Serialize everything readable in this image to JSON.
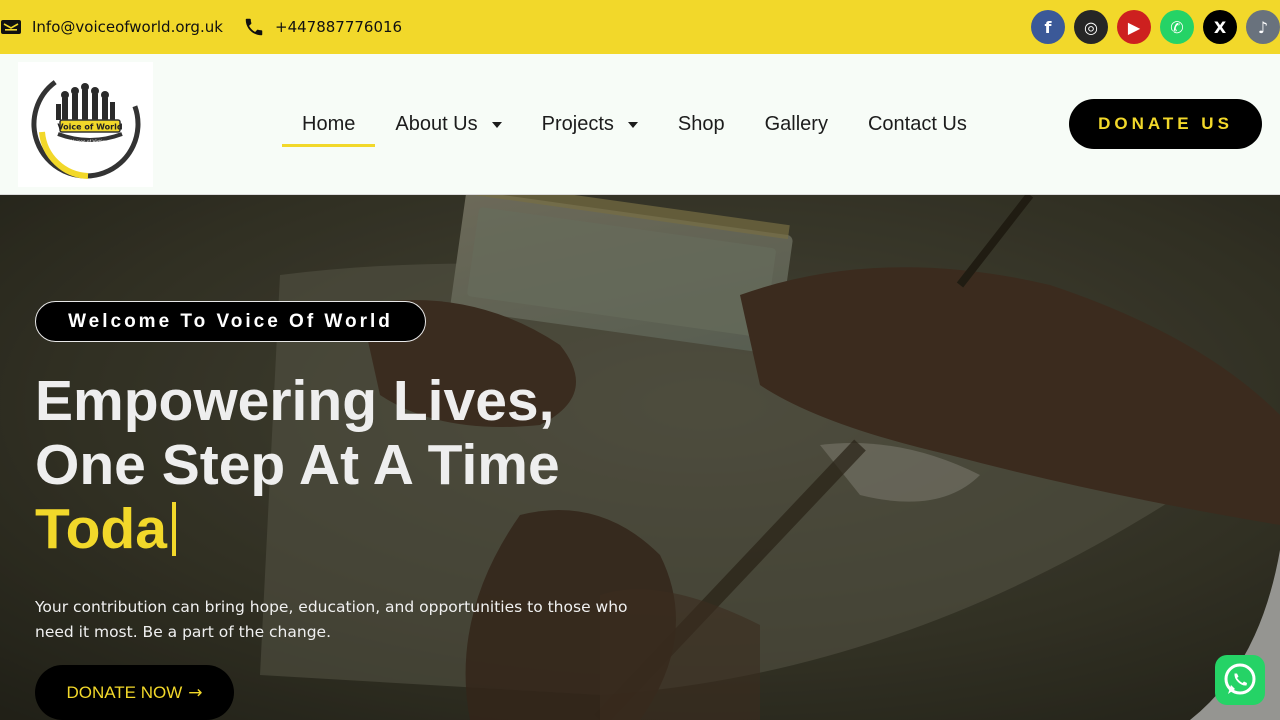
{
  "topbar": {
    "email": "Info@voiceofworld.org.uk",
    "phone": "+447887776016",
    "bg_color": "#f2d82a",
    "icons": {
      "email": "email-icon",
      "phone": "phone-icon"
    },
    "socials": [
      {
        "name": "facebook-icon",
        "glyph": "f",
        "color": "#3b5998"
      },
      {
        "name": "instagram-icon",
        "glyph": "◎",
        "color": "#262626"
      },
      {
        "name": "youtube-icon",
        "glyph": "▶",
        "color": "#cd201f"
      },
      {
        "name": "whatsapp-icon",
        "glyph": "✆",
        "color": "#25d366"
      },
      {
        "name": "x-icon",
        "glyph": "X",
        "color": "#000000"
      },
      {
        "name": "tiktok-icon",
        "glyph": "♪",
        "color": "#69727d"
      }
    ]
  },
  "header": {
    "logo_text": "Voice of World",
    "logo_subtext": "Voices of Victims",
    "nav": [
      {
        "label": "Home",
        "active": true,
        "dropdown": false
      },
      {
        "label": "About Us",
        "active": false,
        "dropdown": true
      },
      {
        "label": "Projects",
        "active": false,
        "dropdown": true
      },
      {
        "label": "Shop",
        "active": false,
        "dropdown": false
      },
      {
        "label": "Gallery",
        "active": false,
        "dropdown": false
      },
      {
        "label": "Contact Us",
        "active": false,
        "dropdown": false
      }
    ],
    "donate_label": "DONATE US"
  },
  "hero": {
    "welcome": "Welcome To Voice Of World",
    "headline_line1": "Empowering Lives,",
    "headline_line2": "One Step At A Time",
    "typed_text": "Toda",
    "subtext": "Your contribution can bring hope, education, and opportunities to those who need it most. Be a part of the change.",
    "cta_label": "DONATE NOW",
    "cta_icon": "arrow-right-icon"
  },
  "floating": {
    "icon": "whatsapp-chat-icon",
    "color": "#25d366"
  }
}
